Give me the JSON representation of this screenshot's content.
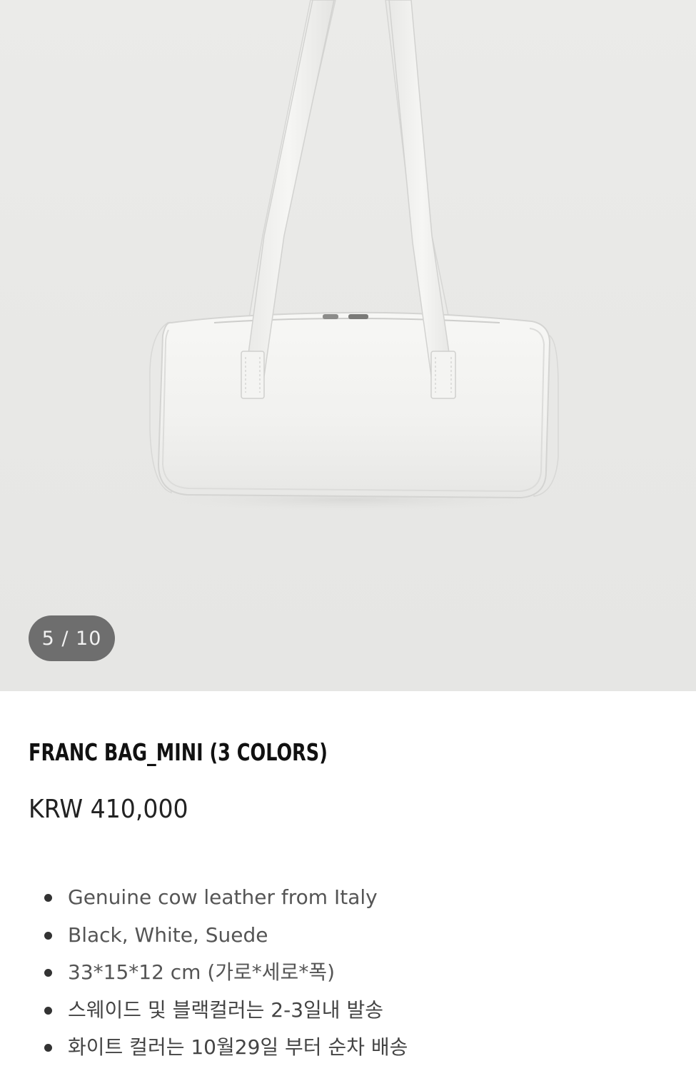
{
  "gallery": {
    "counter": "5 / 10",
    "image_alt": "product-bag-photo"
  },
  "product": {
    "title": "FRANC BAG_MINI (3 COLORS)",
    "price": "KRW 410,000",
    "features": [
      "Genuine cow leather from Italy",
      "Black, White, Suede",
      "33*15*12 cm (가로*세로*폭)",
      "스웨이드 및 블랙컬러는 2-3일내 발송",
      "화이트 컬러는 10월29일 부터 순차 배송"
    ]
  },
  "colors": {
    "gallery_bg": "#e9e9e7",
    "bag": "#f3f3f1",
    "counter_bg": "#6e6e6e"
  }
}
